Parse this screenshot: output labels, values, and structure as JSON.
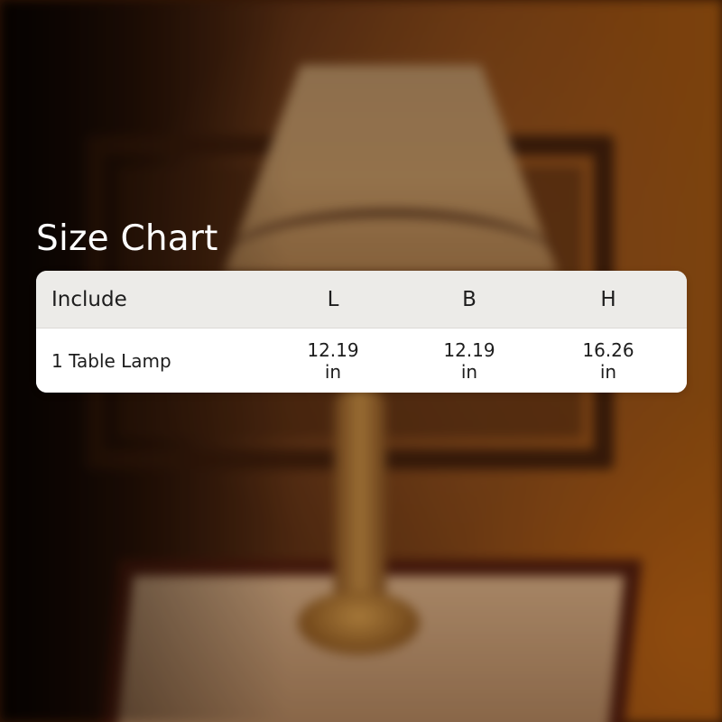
{
  "title": "Size Chart",
  "table": {
    "headers": [
      "Include",
      "L",
      "B",
      "H"
    ],
    "rows": [
      [
        "1 Table Lamp",
        "12.19 in",
        "12.19 in",
        "16.26 in"
      ]
    ]
  },
  "colors": {
    "title_text": "#ffffff",
    "header_bg": "#ecebe8",
    "row_bg": "#ffffff",
    "cell_text": "#1d1d1d"
  }
}
